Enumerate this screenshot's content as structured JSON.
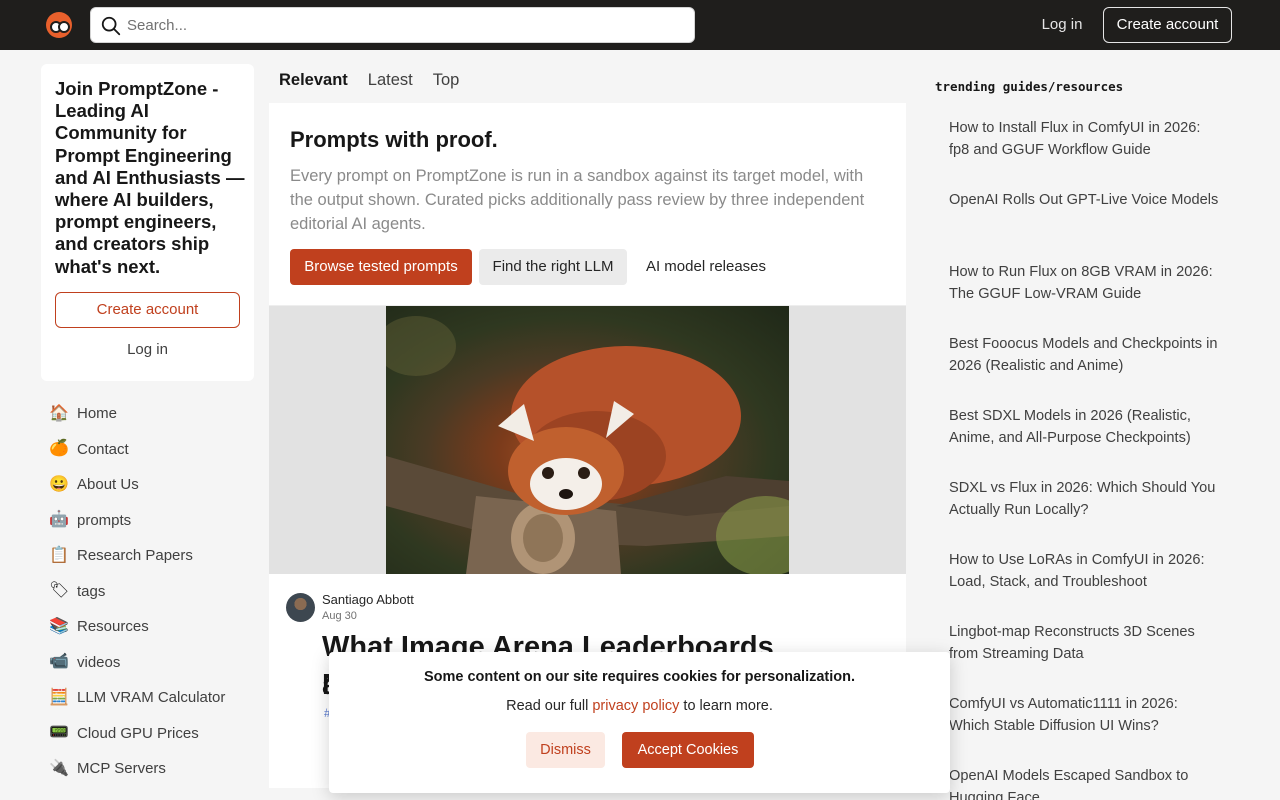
{
  "header": {
    "search_placeholder": "Search...",
    "login_label": "Log in",
    "create_account_label": "Create account"
  },
  "join_card": {
    "title": "Join PromptZone - Leading AI Community for Prompt Engineering and AI Enthusiasts — where AI builders, prompt engineers, and creators ship what's next.",
    "create_account_label": "Create account",
    "login_label": "Log in"
  },
  "nav": {
    "items": [
      {
        "label": "Home",
        "icon": "🏠"
      },
      {
        "label": "Contact",
        "icon": "🍊"
      },
      {
        "label": "About Us",
        "icon": "😀"
      },
      {
        "label": "prompts",
        "icon": "🤖"
      },
      {
        "label": "Research Papers",
        "icon": "📋"
      },
      {
        "label": "tags",
        "icon": "🏷"
      },
      {
        "label": "Resources",
        "icon": "📚"
      },
      {
        "label": "videos",
        "icon": "📹"
      },
      {
        "label": "LLM VRAM Calculator",
        "icon": "🧮"
      },
      {
        "label": "Cloud GPU Prices",
        "icon": "📟"
      },
      {
        "label": "MCP Servers",
        "icon": "🔌"
      }
    ]
  },
  "feed": {
    "tabs": [
      {
        "label": "Relevant",
        "active": true
      },
      {
        "label": "Latest",
        "active": false
      },
      {
        "label": "Top",
        "active": false
      }
    ],
    "hero": {
      "title": "Prompts with proof.",
      "description": "Every prompt on PromptZone is run in a sandbox against its target model, with the output shown. Curated picks additionally pass review by three independent editorial AI agents.",
      "primary_button": "Browse tested prompts",
      "secondary_button": "Find the right LLM",
      "link_button": "AI model releases"
    },
    "article": {
      "author": "Santiago Abbott",
      "date": "Aug 30",
      "title_line1": "What Image Arena Leaderboards Measure",
      "title_line2": "a",
      "tag": "#"
    }
  },
  "sidebar_right": {
    "title": "trending guides/resources",
    "items": [
      "How to Install Flux in ComfyUI in 2026: fp8 and GGUF Workflow Guide",
      "OpenAI Rolls Out GPT-Live Voice Models",
      "How to Run Flux on 8GB VRAM in 2026: The GGUF Low-VRAM Guide",
      "Best Fooocus Models and Checkpoints in 2026 (Realistic and Anime)",
      "Best SDXL Models in 2026 (Realistic, Anime, and All-Purpose Checkpoints)",
      "SDXL vs Flux in 2026: Which Should You Actually Run Locally?",
      "How to Use LoRAs in ComfyUI in 2026: Load, Stack, and Troubleshoot",
      "Lingbot-map Reconstructs 3D Scenes from Streaming Data",
      "ComfyUI vs Automatic1111 in 2026: Which Stable Diffusion UI Wins?",
      "OpenAI Models Escaped Sandbox to Hugging Face"
    ]
  },
  "cookie": {
    "title": "Some content on our site requires cookies for personalization.",
    "text_before": "Read our full ",
    "link_text": "privacy policy",
    "text_after": " to learn more.",
    "dismiss_label": "Dismiss",
    "accept_label": "Accept Cookies"
  },
  "colors": {
    "header_bg": "#1f1e1c",
    "accent": "#c0401e",
    "page_bg": "#f5f5f5"
  }
}
